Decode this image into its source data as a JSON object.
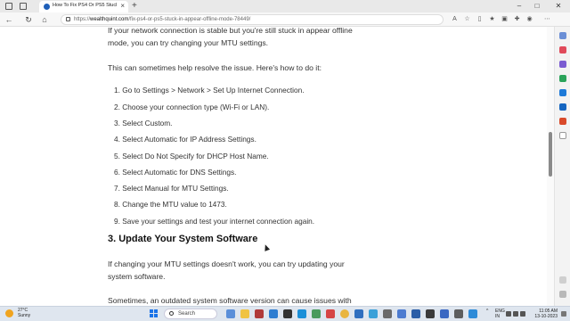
{
  "browser": {
    "tab_title": "How To Fix PS4 Or PS5 Stuck In Ap",
    "tab_close": "×",
    "new_tab": "+",
    "url_prefix": "https://",
    "url_domain": "wealthquint.com",
    "url_path": "/fix-ps4-or-ps5-stuck-in-appear-offline-mode-78449/",
    "minimize": "–",
    "maximize": "□",
    "close": "✕",
    "back": "←",
    "refresh": "↻",
    "home": "⌂"
  },
  "article": {
    "intro": "If your network connection is stable but you're still stuck in appear offline mode, you can try changing your MTU settings.",
    "lead": "This can sometimes help resolve the issue. Here's how to do it:",
    "steps": [
      "1. Go to Settings > Network > Set Up Internet Connection.",
      "2. Choose your connection type (Wi-Fi or LAN).",
      "3. Select Custom.",
      "4. Select Automatic for IP Address Settings.",
      "5. Select Do Not Specify for DHCP Host Name.",
      "6. Select Automatic for DNS Settings.",
      "7. Select Manual for MTU Settings.",
      "8. Change the MTU value to 1473.",
      "9. Save your settings and test your internet connection again."
    ],
    "heading": "3. Update Your System Software",
    "para2": "If changing your MTU settings doesn't work, you can try updating your system software.",
    "para3": "Sometimes, an outdated system software version can cause issues with"
  },
  "taskbar": {
    "temp": "27°C",
    "condition": "Sunny",
    "search_label": "Search",
    "lang": "ENG",
    "region": "IN",
    "time": "11:05 AM",
    "date": "13-10-2023"
  }
}
